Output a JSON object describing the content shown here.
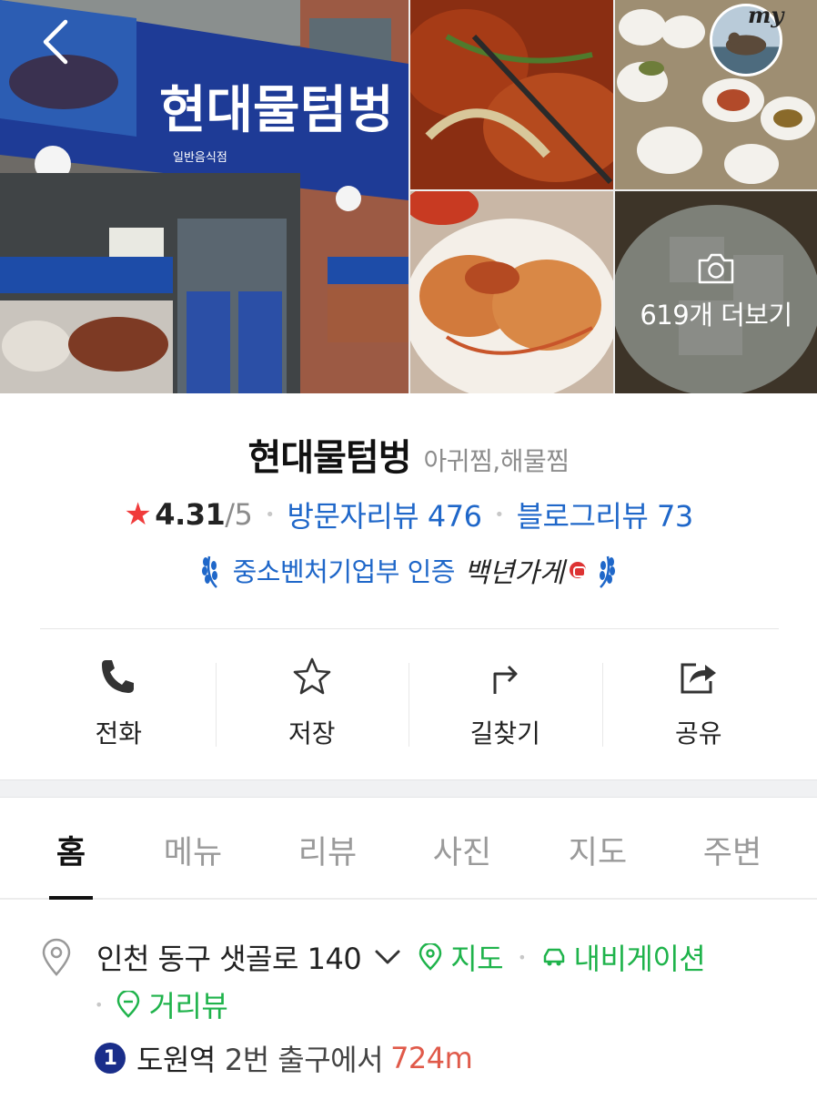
{
  "gallery": {
    "more_label": "619개 더보기",
    "my_label": "my"
  },
  "place": {
    "name": "현대물텀벙",
    "category": "아귀찜,해물찜",
    "rating": "4.31",
    "rating_max": "/5",
    "visitor_review": "방문자리뷰 476",
    "blog_review": "블로그리뷰 73",
    "badge": "중소벤처기업부 인증",
    "badge_mark": "백년가게",
    "sign_text": "현대물텀벙",
    "sign_sub": "일반음식점"
  },
  "actions": [
    {
      "label": "전화",
      "icon": "phone-icon"
    },
    {
      "label": "저장",
      "icon": "star-outline-icon"
    },
    {
      "label": "길찾기",
      "icon": "directions-icon"
    },
    {
      "label": "공유",
      "icon": "share-icon"
    }
  ],
  "tabs": [
    {
      "label": "홈",
      "active": true
    },
    {
      "label": "메뉴",
      "active": false
    },
    {
      "label": "리뷰",
      "active": false
    },
    {
      "label": "사진",
      "active": false
    },
    {
      "label": "지도",
      "active": false
    },
    {
      "label": "주변",
      "active": false
    }
  ],
  "address": {
    "text": "인천 동구 샛골로 140",
    "map_link": "지도",
    "navigation_link": "내비게이션",
    "street_view_link": "거리뷰"
  },
  "subway": {
    "line": "1",
    "station": "도원역",
    "exit": "2번 출구에서",
    "distance": "724m"
  },
  "colors": {
    "link_blue": "#1f67c9",
    "link_green": "#1fb34b",
    "star_red": "#f03b3b",
    "distance_red": "#e05a4a",
    "line1_navy": "#1a2e8a"
  }
}
